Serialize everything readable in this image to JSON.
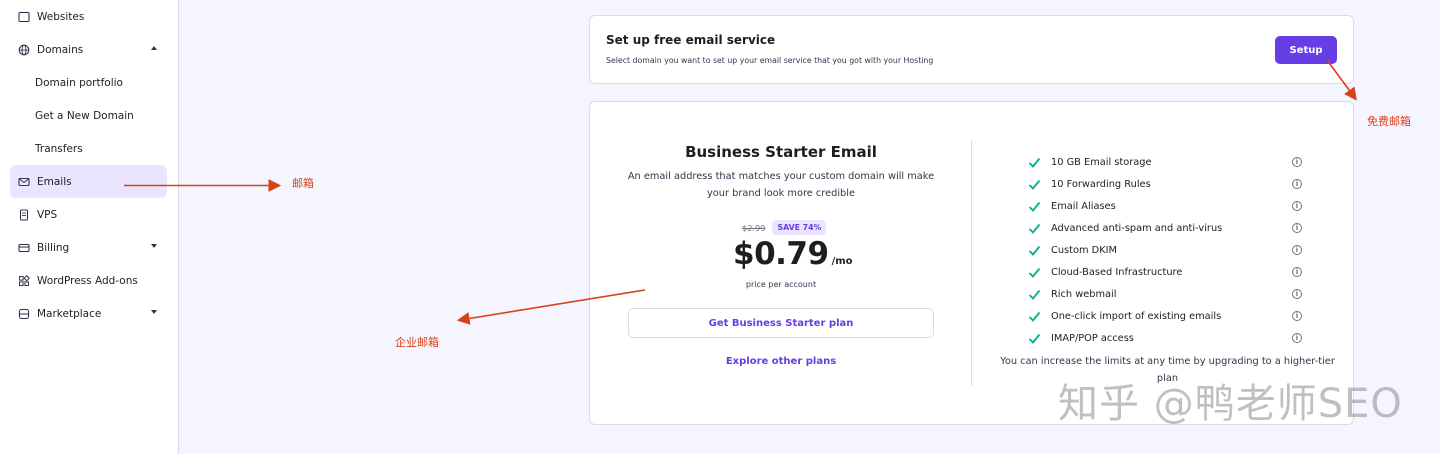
{
  "sidebar": {
    "items": [
      {
        "label": "Websites",
        "icon": "window-icon"
      },
      {
        "label": "Domains",
        "icon": "globe-icon",
        "expanded": true
      },
      {
        "label": "Domain portfolio"
      },
      {
        "label": "Get a New Domain"
      },
      {
        "label": "Transfers"
      },
      {
        "label": "Emails",
        "icon": "envelope-icon",
        "active": true
      },
      {
        "label": "VPS",
        "icon": "server-icon"
      },
      {
        "label": "Billing",
        "icon": "credit-card-icon"
      },
      {
        "label": "WordPress Add-ons",
        "icon": "puzzle-icon"
      },
      {
        "label": "Marketplace",
        "icon": "store-icon"
      }
    ]
  },
  "free_email": {
    "title": "Set up free email service",
    "subtitle": "Select domain you want to set up your email service that you got with your Hosting",
    "setup_label": "Setup"
  },
  "plan": {
    "title": "Business Starter Email",
    "description": "An email address that matches your custom domain will make your brand look more credible",
    "old_price": "$2.99",
    "save_badge": "SAVE 74%",
    "price": "$0.79",
    "per": "/mo",
    "price_note": "price per account",
    "cta_label": "Get Business Starter plan",
    "other_plans_label": "Explore other plans",
    "features": [
      "10 GB Email storage",
      "10 Forwarding Rules",
      "Email Aliases",
      "Advanced anti-spam and anti-virus",
      "Custom DKIM",
      "Cloud-Based Infrastructure",
      "Rich webmail",
      "One-click import of existing emails",
      "IMAP/POP access"
    ],
    "upgrade_note": "You can increase the limits at any time by upgrading to a higher-tier plan"
  },
  "annotations": {
    "email": "邮箱",
    "business_email": "企业邮箱",
    "free_email": "免费邮箱"
  },
  "watermark": "知乎 @鸭老师SEO",
  "colors": {
    "accent": "#673de6",
    "active_bg": "#ebe4ff",
    "check": "#00b090",
    "annotation": "#d8421a"
  }
}
